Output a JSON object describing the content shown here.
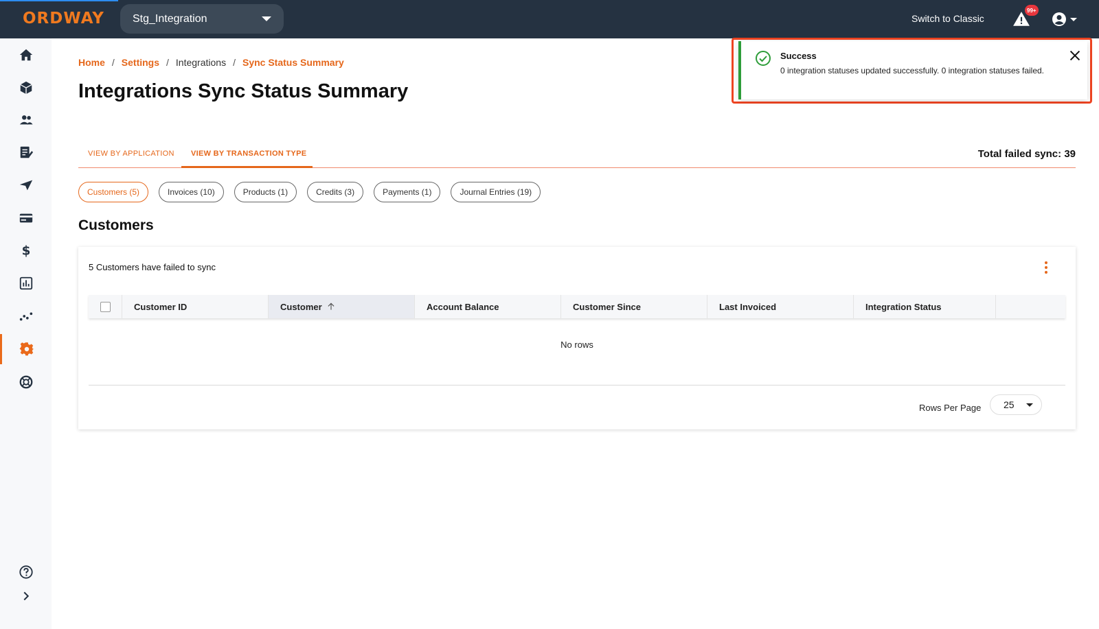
{
  "app": {
    "logo_text": "ORDWAY",
    "brand_color": "#e5671b",
    "topbar_color": "#253241"
  },
  "header": {
    "org_selector": "Stg_Integration",
    "switch_classic": "Switch to Classic",
    "alerts_badge": "99+",
    "alert_icon": "warning-icon",
    "account_icon": "account-circle-icon"
  },
  "sidebar": {
    "items": [
      {
        "icon": "home-icon"
      },
      {
        "icon": "cube-icon"
      },
      {
        "icon": "people-icon"
      },
      {
        "icon": "edit-document-icon"
      },
      {
        "icon": "send-icon"
      },
      {
        "icon": "credit-card-icon"
      },
      {
        "icon": "dollar-icon"
      },
      {
        "icon": "bar-chart-icon"
      },
      {
        "icon": "scatter-icon"
      },
      {
        "icon": "gear-icon",
        "active": true
      },
      {
        "icon": "lifebuoy-icon"
      }
    ],
    "bottom": [
      {
        "icon": "help-icon"
      },
      {
        "icon": "chevron-right-icon"
      }
    ]
  },
  "breadcrumb": {
    "home": "Home",
    "settings": "Settings",
    "integrations": "Integrations",
    "current": "Sync Status Summary",
    "separator": "/"
  },
  "page": {
    "title": "Integrations Sync Status Summary"
  },
  "toast": {
    "status": "success",
    "title": "Success",
    "message": "0 integration statuses updated successfully. 0 integration statuses failed.",
    "accent_color": "#2e9d3a"
  },
  "tabs": {
    "items": [
      {
        "label": "VIEW BY APPLICATION",
        "active": false
      },
      {
        "label": "VIEW BY TRANSACTION TYPE",
        "active": true
      }
    ],
    "total_failed": "Total failed sync: 39"
  },
  "filters": {
    "chips": [
      {
        "label": "Customers (5)",
        "selected": true
      },
      {
        "label": "Invoices (10)",
        "selected": false
      },
      {
        "label": "Products (1)",
        "selected": false
      },
      {
        "label": "Credits (3)",
        "selected": false
      },
      {
        "label": "Payments (1)",
        "selected": false
      },
      {
        "label": "Journal Entries (19)",
        "selected": false
      }
    ]
  },
  "section": {
    "title": "Customers"
  },
  "table": {
    "heading": "5 Customers have failed to sync",
    "columns": [
      {
        "label": "Customer ID",
        "sorted": false
      },
      {
        "label": "Customer",
        "sorted": true,
        "sort_dir": "asc"
      },
      {
        "label": "Account Balance",
        "sorted": false
      },
      {
        "label": "Customer Since",
        "sorted": false
      },
      {
        "label": "Last Invoiced",
        "sorted": false
      },
      {
        "label": "Integration Status",
        "sorted": false
      }
    ],
    "rows": [],
    "empty_text": "No rows",
    "rows_per_page_label": "Rows Per Page",
    "rows_per_page": "25"
  }
}
